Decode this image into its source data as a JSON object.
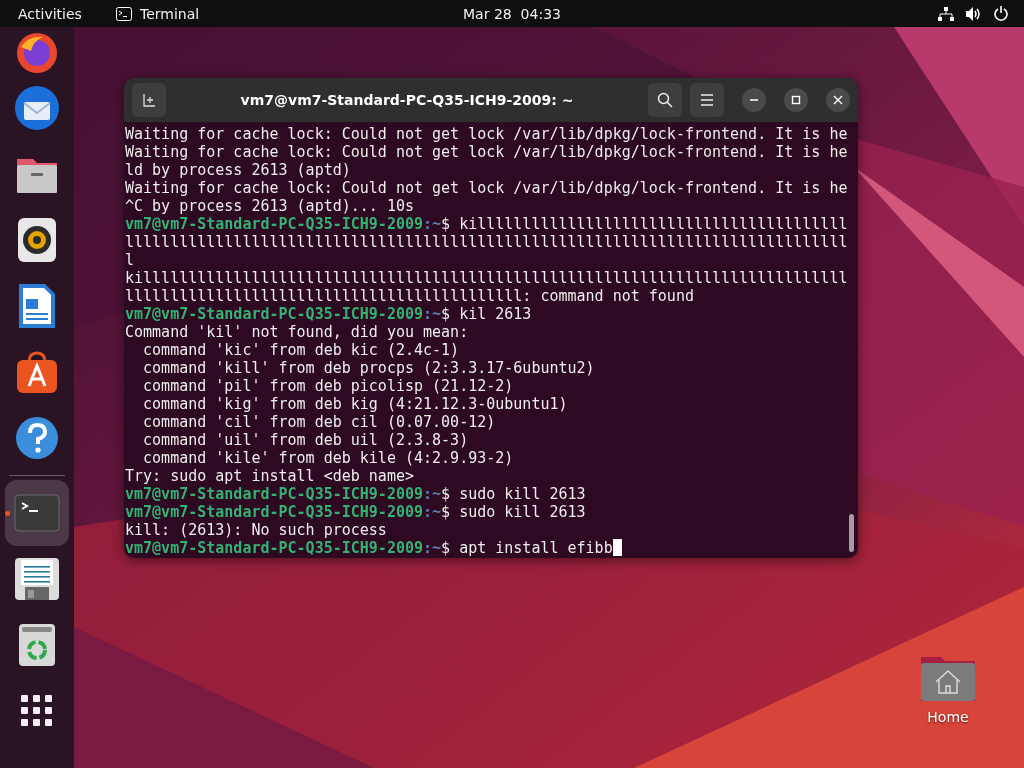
{
  "top_bar": {
    "activities": "Activities",
    "app_name": "Terminal",
    "clock": "Mar 28  04:33"
  },
  "dock": {
    "items": [
      {
        "kind": "firefox",
        "running": false
      },
      {
        "kind": "thunderbird",
        "running": false
      },
      {
        "kind": "files",
        "running": false
      },
      {
        "kind": "rhythmbox",
        "running": false
      },
      {
        "kind": "writer",
        "running": false
      },
      {
        "kind": "app-center",
        "running": false
      },
      {
        "kind": "help",
        "running": false
      },
      {
        "kind": "terminal",
        "running": true
      },
      {
        "kind": "text-editor",
        "running": false
      },
      {
        "kind": "trash",
        "running": false
      },
      {
        "kind": "app-grid",
        "running": false
      }
    ]
  },
  "terminal": {
    "title": "vm7@vm7-Standard-PC-Q35-ICH9-2009: ~",
    "cursor_visible": true,
    "lines": [
      {
        "kind": "output",
        "text": "Waiting for cache lock: Could not get lock /var/lib/dpkg/lock-frontend. It is he"
      },
      {
        "kind": "output",
        "text": "Waiting for cache lock: Could not get lock /var/lib/dpkg/lock-frontend. It is he"
      },
      {
        "kind": "output",
        "text": "ld by process 2613 (aptd)"
      },
      {
        "kind": "output",
        "text": "Waiting for cache lock: Could not get lock /var/lib/dpkg/lock-frontend. It is he"
      },
      {
        "kind": "output",
        "text": "^C by process 2613 (aptd)... 10s"
      },
      {
        "kind": "prompt",
        "user_host": "vm7@vm7-Standard-PC-Q35-ICH9-2009",
        "path": ":~",
        "command": "$ killlllllllllllllllllllllllllllllllllllllll"
      },
      {
        "kind": "output",
        "text": "llllllllllllllllllllllllllllllllllllllllllllllllllllllllllllllllllllllllllllllll"
      },
      {
        "kind": "output",
        "text": "l"
      },
      {
        "kind": "output",
        "text": "killllllllllllllllllllllllllllllllllllllllllllllllllllllllllllllllllllllllllllll"
      },
      {
        "kind": "output",
        "text": "llllllllllllllllllllllllllllllllllllllllllll: command not found"
      },
      {
        "kind": "prompt",
        "user_host": "vm7@vm7-Standard-PC-Q35-ICH9-2009",
        "path": ":~",
        "command": "$ kil 2613"
      },
      {
        "kind": "output",
        "text": "Command 'kil' not found, did you mean:"
      },
      {
        "kind": "output",
        "text": "  command 'kic' from deb kic (2.4c-1)"
      },
      {
        "kind": "output",
        "text": "  command 'kill' from deb procps (2:3.3.17-6ubuntu2)"
      },
      {
        "kind": "output",
        "text": "  command 'pil' from deb picolisp (21.12-2)"
      },
      {
        "kind": "output",
        "text": "  command 'kig' from deb kig (4:21.12.3-0ubuntu1)"
      },
      {
        "kind": "output",
        "text": "  command 'cil' from deb cil (0.07.00-12)"
      },
      {
        "kind": "output",
        "text": "  command 'uil' from deb uil (2.3.8-3)"
      },
      {
        "kind": "output",
        "text": "  command 'kile' from deb kile (4:2.9.93-2)"
      },
      {
        "kind": "output",
        "text": "Try: sudo apt install <deb name>"
      },
      {
        "kind": "prompt",
        "user_host": "vm7@vm7-Standard-PC-Q35-ICH9-2009",
        "path": ":~",
        "command": "$ sudo kill 2613"
      },
      {
        "kind": "prompt",
        "user_host": "vm7@vm7-Standard-PC-Q35-ICH9-2009",
        "path": ":~",
        "command": "$ sudo kill 2613"
      },
      {
        "kind": "output",
        "text": "kill: (2613): No such process"
      },
      {
        "kind": "prompt",
        "user_host": "vm7@vm7-Standard-PC-Q35-ICH9-2009",
        "path": ":~",
        "command": "$ apt install efibb"
      }
    ]
  },
  "desktop_icons": [
    {
      "label": "Home"
    }
  ]
}
